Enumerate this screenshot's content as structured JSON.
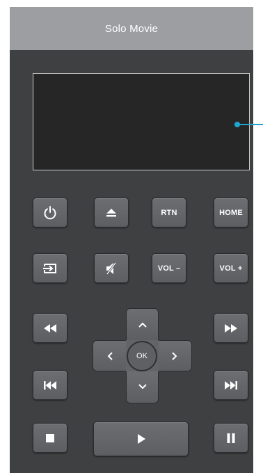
{
  "app": {
    "title": "Solo Movie"
  },
  "colors": {
    "accent": "#1ea8d1",
    "panel": "#3f4042",
    "titlebar": "#9c9ea1"
  },
  "buttons": {
    "power": {
      "icon": "power-icon"
    },
    "eject": {
      "icon": "eject-icon"
    },
    "rtn": {
      "label": "RTN"
    },
    "home": {
      "label": "HOME"
    },
    "input": {
      "icon": "input-icon"
    },
    "mute": {
      "icon": "mute-icon"
    },
    "vol_down": {
      "label": "VOL –"
    },
    "vol_up": {
      "label": "VOL +"
    },
    "rewind": {
      "icon": "rewind-icon"
    },
    "fast_forward": {
      "icon": "fast-forward-icon"
    },
    "prev": {
      "icon": "skip-previous-icon"
    },
    "next": {
      "icon": "skip-next-icon"
    },
    "stop": {
      "icon": "stop-icon"
    },
    "play": {
      "icon": "play-icon"
    },
    "pause": {
      "icon": "pause-icon"
    }
  },
  "dpad": {
    "ok_label": "OK",
    "up_icon": "chevron-up-icon",
    "down_icon": "chevron-down-icon",
    "left_icon": "chevron-left-icon",
    "right_icon": "chevron-right-icon"
  }
}
